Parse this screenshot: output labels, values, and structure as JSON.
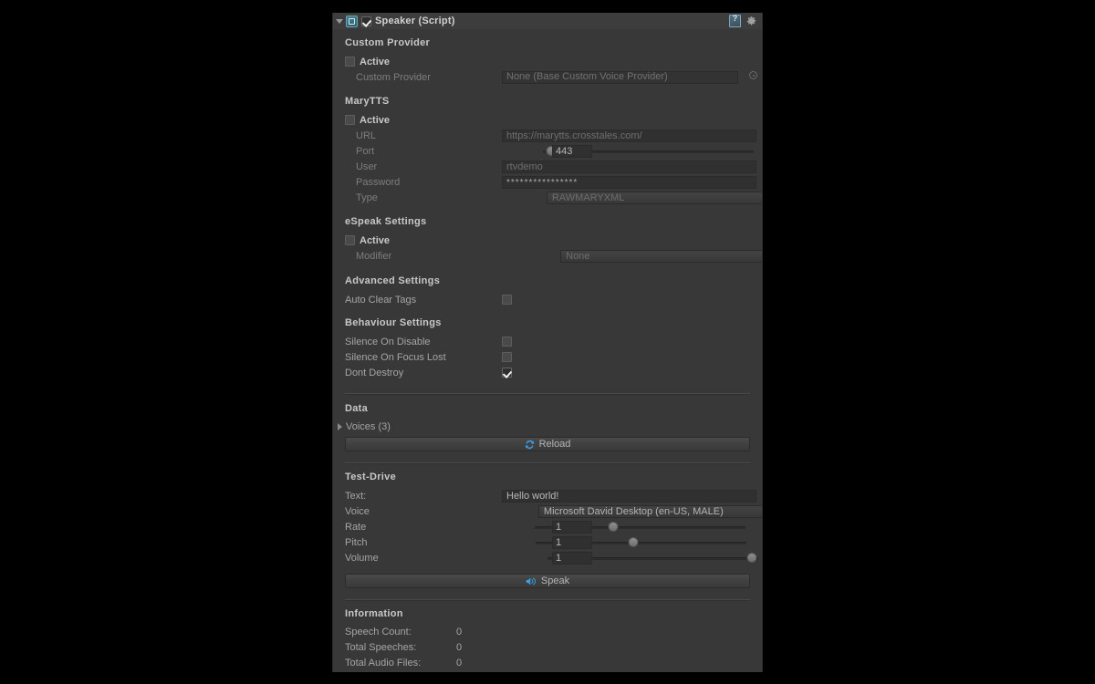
{
  "window": {
    "panel_name": "Inspector",
    "background_color": "#383838",
    "accent_color": "#3b9ee8"
  },
  "component": {
    "title": "Speaker (Script)",
    "enabled": true,
    "expanded": true,
    "script_icon": "csharp-script-icon",
    "help_icon": "help-book-icon",
    "menu_icon": "gear-icon"
  },
  "sections": {
    "custom_provider": {
      "title": "Custom Provider",
      "active_label": "Active",
      "active_checked": false,
      "provider_label": "Custom Provider",
      "provider_value": "None (Base Custom Voice Provider)"
    },
    "marytts": {
      "title": "MaryTTS",
      "active_label": "Active",
      "active_checked": false,
      "fields": {
        "url_label": "URL",
        "url_value": "https://marytts.crosstales.com/",
        "port_label": "Port",
        "port_value": "443",
        "port_slider_pct": 4,
        "user_label": "User",
        "user_value": "rtvdemo",
        "password_label": "Password",
        "password_value": "****************",
        "type_label": "Type",
        "type_value": "RAWMARYXML"
      }
    },
    "espeak": {
      "title": "eSpeak Settings",
      "active_label": "Active",
      "active_checked": false,
      "modifier_label": "Modifier",
      "modifier_value": "None"
    },
    "advanced": {
      "title": "Advanced Settings",
      "auto_clear_tags_label": "Auto Clear Tags",
      "auto_clear_tags_checked": false
    },
    "behaviour": {
      "title": "Behaviour Settings",
      "rows": [
        {
          "label": "Silence On Disable",
          "checked": false
        },
        {
          "label": "Silence On Focus Lost",
          "checked": false
        },
        {
          "label": "Dont Destroy",
          "checked": true
        }
      ]
    },
    "data": {
      "title": "Data",
      "voices_label": "Voices (3)",
      "voices_expanded": false,
      "reload_button": "Reload",
      "reload_icon": "refresh-icon"
    },
    "test_drive": {
      "title": "Test-Drive",
      "text_label": "Text:",
      "text_value": "Hello world!",
      "voice_label": "Voice",
      "voice_value": "Microsoft David Desktop (en-US, MALE)",
      "sliders": [
        {
          "label": "Rate",
          "value": "1",
          "pct": 37
        },
        {
          "label": "Pitch",
          "value": "1",
          "pct": 46
        },
        {
          "label": "Volume",
          "value": "1",
          "pct": 97
        }
      ],
      "speak_button": "Speak",
      "speak_icon": "speaker-icon"
    },
    "information": {
      "title": "Information",
      "rows": [
        {
          "label": "Speech Count:",
          "value": "0"
        },
        {
          "label": "Total Speeches:",
          "value": "0"
        },
        {
          "label": "Total Audio Files:",
          "value": "0"
        }
      ]
    }
  }
}
